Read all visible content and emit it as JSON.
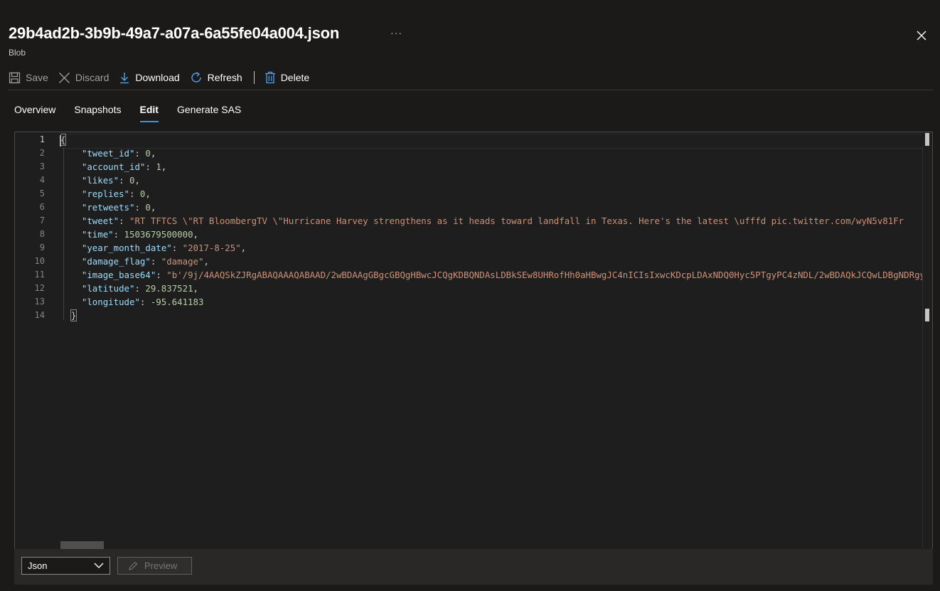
{
  "header": {
    "title": "29b4ad2b-3b9b-49a7-a07a-6a55fe04a004.json",
    "more": "···",
    "subtitle": "Blob"
  },
  "toolbar": {
    "save": "Save",
    "discard": "Discard",
    "download": "Download",
    "refresh": "Refresh",
    "delete": "Delete"
  },
  "tabs": [
    "Overview",
    "Snapshots",
    "Edit",
    "Generate SAS"
  ],
  "active_tab": "Edit",
  "editor": {
    "line_numbers": [
      "1",
      "2",
      "3",
      "4",
      "5",
      "6",
      "7",
      "8",
      "9",
      "10",
      "11",
      "12",
      "13",
      "14"
    ],
    "lines": [
      {
        "key": "tweet_id",
        "value": "0",
        "type": "number",
        "comma": ","
      },
      {
        "key": "account_id",
        "value": "1",
        "type": "number",
        "comma": ","
      },
      {
        "key": "likes",
        "value": "0",
        "type": "number",
        "comma": ","
      },
      {
        "key": "replies",
        "value": "0",
        "type": "number",
        "comma": ","
      },
      {
        "key": "retweets",
        "value": "0",
        "type": "number",
        "comma": ","
      },
      {
        "key": "tweet",
        "value": "\"RT TFTCS \\\"RT BloombergTV \\\"Hurricane Harvey strengthens as it heads toward landfall in Texas. Here's the latest \\ufffd pic.twitter.com/wyN5v81Fr",
        "type": "string",
        "comma": ""
      },
      {
        "key": "time",
        "value": "1503679500000",
        "type": "number",
        "comma": ","
      },
      {
        "key": "year_month_date",
        "value": "\"2017-8-25\"",
        "type": "string",
        "comma": ","
      },
      {
        "key": "damage_flag",
        "value": "\"damage\"",
        "type": "string",
        "comma": ","
      },
      {
        "key": "image_base64",
        "value": "\"b'/9j/4AAQSkZJRgABAQAAAQABAAD/2wBDAAgGBgcGBQgHBwcJCQgKDBQNDAsLDBkSEw8UHRofHh0aHBwgJC4nICIsIxwcKDcpLDAxNDQ0Hyc5PTgyPC4zNDL/2wBDAQkJCQwLDBgNDRgy",
        "type": "string",
        "comma": ""
      },
      {
        "key": "latitude",
        "value": "29.837521",
        "type": "number",
        "comma": ","
      },
      {
        "key": "longitude",
        "value": "-95.641183",
        "type": "number",
        "comma": ""
      }
    ],
    "open_brace": "{",
    "close_brace": "}"
  },
  "footer": {
    "language": "Json",
    "preview": "Preview"
  },
  "icons": {
    "save": "save-icon",
    "discard": "close-icon",
    "download": "download-icon",
    "refresh": "refresh-icon",
    "delete": "trash-icon",
    "close": "close-icon",
    "chevron": "chevron-down-icon",
    "preview": "pencil-icon"
  },
  "colors": {
    "accent": "#2899f5",
    "json_key": "#9cdcfe",
    "json_string": "#ce9178",
    "json_number": "#b5cea8"
  }
}
